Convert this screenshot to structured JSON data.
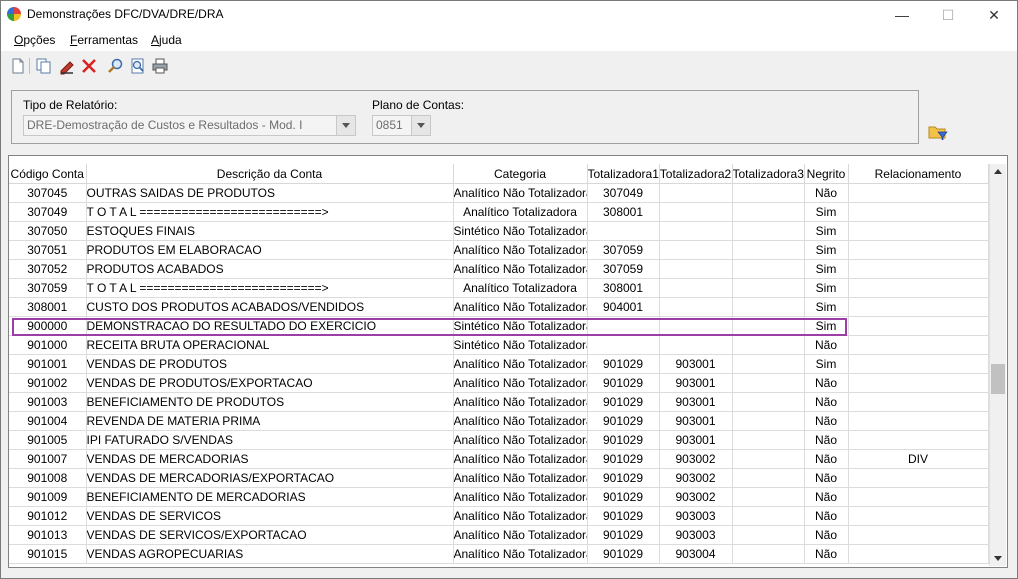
{
  "window": {
    "title": "Demonstrações DFC/DVA/DRE/DRA",
    "minimize_label": "—",
    "maximize_label": "☐",
    "close_label": "✕"
  },
  "menu": {
    "items": [
      {
        "first": "O",
        "rest": "pções"
      },
      {
        "first": "F",
        "rest": "erramentas"
      },
      {
        "first": "A",
        "rest": "juda"
      }
    ]
  },
  "toolbar": {
    "icons": [
      "new-document-icon",
      "copy-icon",
      "edit-pencil-icon",
      "delete-x-icon",
      "search-icon",
      "zoom-preview-icon",
      "print-icon"
    ]
  },
  "filters": {
    "tipo_label": "Tipo de Relatório:",
    "tipo_value": "DRE-Demostração de Custos e Resultados - Mod. I",
    "plano_label": "Plano de Contas:",
    "plano_value": "0851",
    "open_folder_icon": "open-folder-filter-icon"
  },
  "grid": {
    "columns": [
      "Código Conta",
      "Descrição da Conta",
      "Categoria",
      "Totalizadora1",
      "Totalizadora2",
      "Totalizadora3",
      "Negrito",
      "Relacionamento"
    ],
    "highlighted_row": 7,
    "highlight_color": "#9b3ea6",
    "rows": [
      [
        "307045",
        "OUTRAS SAIDAS DE PRODUTOS",
        "Analítico Não Totalizadora",
        "307049",
        "",
        "",
        "Não",
        ""
      ],
      [
        "307049",
        "T O T A L ==========================>",
        "Analítico Totalizadora",
        "308001",
        "",
        "",
        "Sim",
        ""
      ],
      [
        "307050",
        "ESTOQUES FINAIS",
        "Sintético Não Totalizadora",
        "",
        "",
        "",
        "Sim",
        ""
      ],
      [
        "307051",
        "PRODUTOS EM ELABORACAO",
        "Analítico Não Totalizadora",
        "307059",
        "",
        "",
        "Sim",
        ""
      ],
      [
        "307052",
        "PRODUTOS ACABADOS",
        "Analítico Não Totalizadora",
        "307059",
        "",
        "",
        "Sim",
        ""
      ],
      [
        "307059",
        "T O T A L ==========================>",
        "Analítico Totalizadora",
        "308001",
        "",
        "",
        "Sim",
        ""
      ],
      [
        "308001",
        "CUSTO DOS PRODUTOS ACABADOS/VENDIDOS",
        "Analítico Não Totalizadora",
        "904001",
        "",
        "",
        "Sim",
        ""
      ],
      [
        "900000",
        "DEMONSTRACAO DO RESULTADO DO EXERCICIO",
        "Sintético Não Totalizadora",
        "",
        "",
        "",
        "Sim",
        ""
      ],
      [
        "901000",
        "RECEITA BRUTA OPERACIONAL",
        "Sintético Não Totalizadora",
        "",
        "",
        "",
        "Não",
        ""
      ],
      [
        "901001",
        "VENDAS DE PRODUTOS",
        "Analítico Não Totalizadora",
        "901029",
        "903001",
        "",
        "Sim",
        ""
      ],
      [
        "901002",
        "VENDAS DE PRODUTOS/EXPORTACAO",
        "Analítico Não Totalizadora",
        "901029",
        "903001",
        "",
        "Não",
        ""
      ],
      [
        "901003",
        "BENEFICIAMENTO DE PRODUTOS",
        "Analítico Não Totalizadora",
        "901029",
        "903001",
        "",
        "Não",
        ""
      ],
      [
        "901004",
        "REVENDA DE MATERIA PRIMA",
        "Analítico Não Totalizadora",
        "901029",
        "903001",
        "",
        "Não",
        ""
      ],
      [
        "901005",
        "IPI FATURADO S/VENDAS",
        "Analítico Não Totalizadora",
        "901029",
        "903001",
        "",
        "Não",
        ""
      ],
      [
        "901007",
        "VENDAS DE MERCADORIAS",
        "Analítico Não Totalizadora",
        "901029",
        "903002",
        "",
        "Não",
        "DIV"
      ],
      [
        "901008",
        "VENDAS DE MERCADORIAS/EXPORTACAO",
        "Analítico Não Totalizadora",
        "901029",
        "903002",
        "",
        "Não",
        ""
      ],
      [
        "901009",
        "BENEFICIAMENTO DE MERCADORIAS",
        "Analítico Não Totalizadora",
        "901029",
        "903002",
        "",
        "Não",
        ""
      ],
      [
        "901012",
        "VENDAS DE SERVICOS",
        "Analítico Não Totalizadora",
        "901029",
        "903003",
        "",
        "Não",
        ""
      ],
      [
        "901013",
        "VENDAS DE SERVICOS/EXPORTACAO",
        "Analítico Não Totalizadora",
        "901029",
        "903003",
        "",
        "Não",
        ""
      ],
      [
        "901015",
        "VENDAS AGROPECUARIAS",
        "Analítico Não Totalizadora",
        "901029",
        "903004",
        "",
        "Não",
        ""
      ]
    ]
  }
}
